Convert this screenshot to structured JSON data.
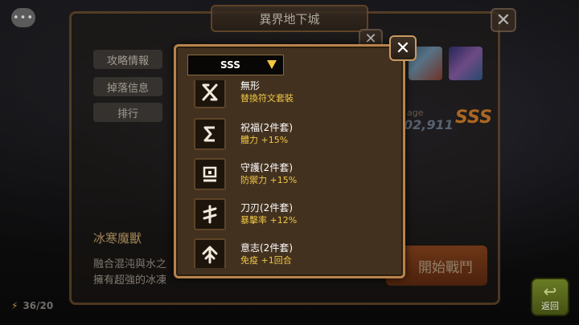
{
  "chat": {
    "icon": "chat-bubble-icon",
    "glyph": "•••"
  },
  "back": {
    "title": "異界地下城",
    "tabs": [
      "攻略情報",
      "掉落信息",
      "排行"
    ],
    "damage_label": "age",
    "damage_value": "02,911",
    "rank_badge": "SSS",
    "boss_name": "冰寒魔獸",
    "boss_desc_1": "融合混沌與水之",
    "boss_desc_2": "擁有超強的冰凍",
    "start_button": "開始戰鬥",
    "energy": "36/20",
    "return_button": "返回"
  },
  "popup": {
    "dropdown_value": "SSS",
    "runes": [
      {
        "name": "無形",
        "effect": "替換符文套裝",
        "icon": "rune-x-icon"
      },
      {
        "name": "祝福(2件套)",
        "effect": "體力 +15%",
        "icon": "rune-sigma-icon"
      },
      {
        "name": "守護(2件套)",
        "effect": "防禦力 +15%",
        "icon": "rune-shield-icon"
      },
      {
        "name": "刀刃(2件套)",
        "effect": "暴擊率 +12%",
        "icon": "rune-blade-icon"
      },
      {
        "name": "意志(2件套)",
        "effect": "免疫 +1回合",
        "icon": "rune-arrow-icon"
      }
    ]
  },
  "colors": {
    "accent": "#f0c844",
    "frame": "#b8834a",
    "panel": "#43311f"
  }
}
